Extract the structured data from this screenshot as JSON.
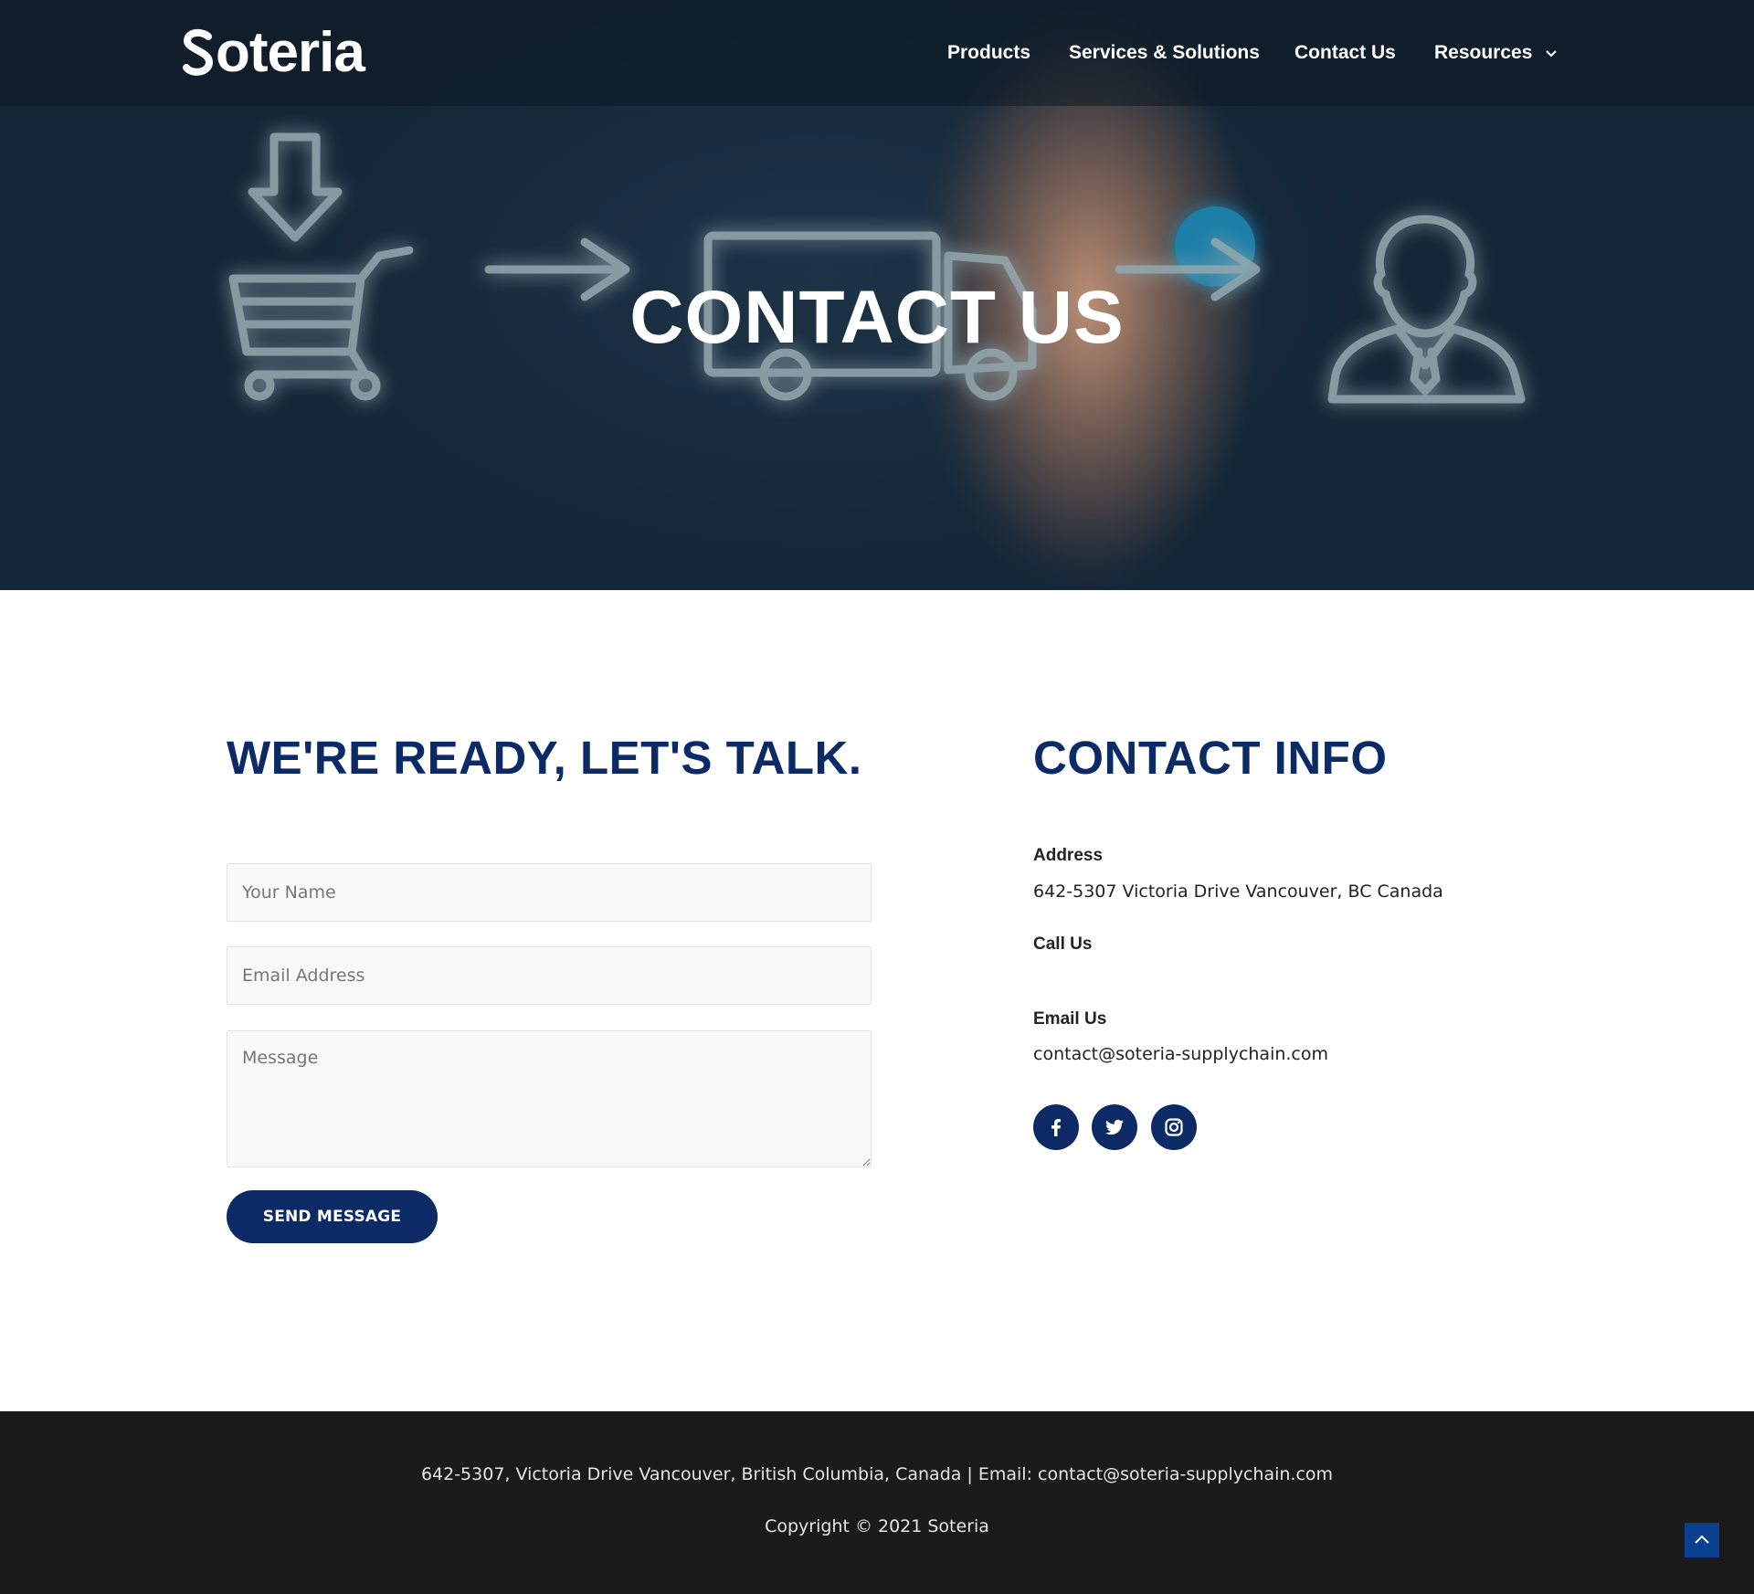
{
  "header": {
    "logo_text": "Soteria",
    "nav": [
      {
        "label": "Products"
      },
      {
        "label": "Services & Solutions"
      },
      {
        "label": "Contact Us"
      },
      {
        "label": "Resources",
        "has_dropdown": true,
        "icon": "chevron-down-icon"
      }
    ]
  },
  "hero": {
    "title": "CONTACT US",
    "background_icons": [
      "download-arrow-icon",
      "shopping-cart-icon",
      "arrow-right-icon",
      "delivery-truck-icon",
      "person-icon"
    ]
  },
  "contact_form": {
    "heading": "WE'RE READY, LET'S TALK.",
    "name_placeholder": "Your Name",
    "email_placeholder": "Email Address",
    "message_placeholder": "Message",
    "submit_label": "SEND MESSAGE"
  },
  "contact_info": {
    "heading": "CONTACT INFO",
    "address_label": "Address",
    "address_value": "642-5307 Victoria Drive Vancouver, BC Canada",
    "call_label": "Call Us",
    "email_label": "Email Us",
    "email_value": "contact@soteria-supplychain.com",
    "social": [
      "facebook-icon",
      "twitter-icon",
      "instagram-icon"
    ]
  },
  "footer": {
    "address_line": "642-5307, Victoria Drive Vancouver, British Columbia, Canada | Email: contact@soteria-supplychain.com",
    "copyright": "Copyright © 2021 Soteria",
    "back_to_top_icon": "chevron-up-icon"
  },
  "colors": {
    "brand_navy": "#0b2a66",
    "footer_bg": "#1a1a1a",
    "hero_bg": "#142637",
    "back_to_top": "#0b3f8f"
  }
}
